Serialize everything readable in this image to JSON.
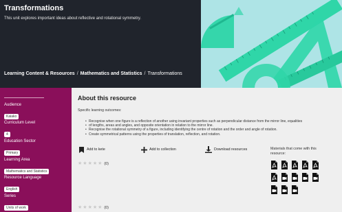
{
  "header": {
    "title": "Transformations",
    "description": "This unit explores important ideas about reflective and rotational symmetry.",
    "breadcrumb": [
      {
        "label": "Learning Content & Resources"
      },
      {
        "label": "Mathematics and Statistics"
      },
      {
        "label": "Transformations"
      }
    ],
    "separator": "/"
  },
  "sidebar": {
    "facets": [
      {
        "label": "Audience",
        "value": "Kaiako"
      },
      {
        "label": "Curriculum Level",
        "value": "4"
      },
      {
        "label": "Education Sector",
        "value": "Primary"
      },
      {
        "label": "Learning Area",
        "value": "Mathematics and Statistics"
      },
      {
        "label": "Resource Language",
        "value": "English"
      },
      {
        "label": "Series",
        "value": "Units of work"
      }
    ]
  },
  "main": {
    "heading": "About this resource",
    "subheading": "Specific learning outcomes:",
    "outcomes": [
      "Recognise when one figure is a reflection of another using invariant properties such as perpendicular distance from the mirror line, equalities",
      "of lengths, areas and angles, and opposite orientation in relation to the mirror line.",
      "Recognise the rotational symmetry of a figure, including identifying the centre of rotation and the order and angle of rotation.",
      "Create symmetrical patterns using the properties of translation, reflection, and rotation."
    ],
    "actions": {
      "kete": "Add to kete",
      "collection": "Add to collection",
      "download": "Download resources"
    },
    "rating": {
      "count_text": "(0)",
      "value": 0,
      "max": 5
    },
    "materials_label": "Materials that come with this resource:",
    "materials": {
      "row1": [
        "pdf",
        "pdf",
        "pdf",
        "pdf",
        "pdf"
      ],
      "row2": [
        "pdf",
        "video",
        "video",
        "video",
        "video"
      ],
      "row3": [
        "video",
        "video",
        "video"
      ]
    }
  },
  "colors": {
    "header_bg": "#20242c",
    "sidebar_bg": "#8a0f5a",
    "main_bg": "#efefef",
    "hero_bg": "#aee4e6",
    "ruler": "#2fd6a8"
  }
}
